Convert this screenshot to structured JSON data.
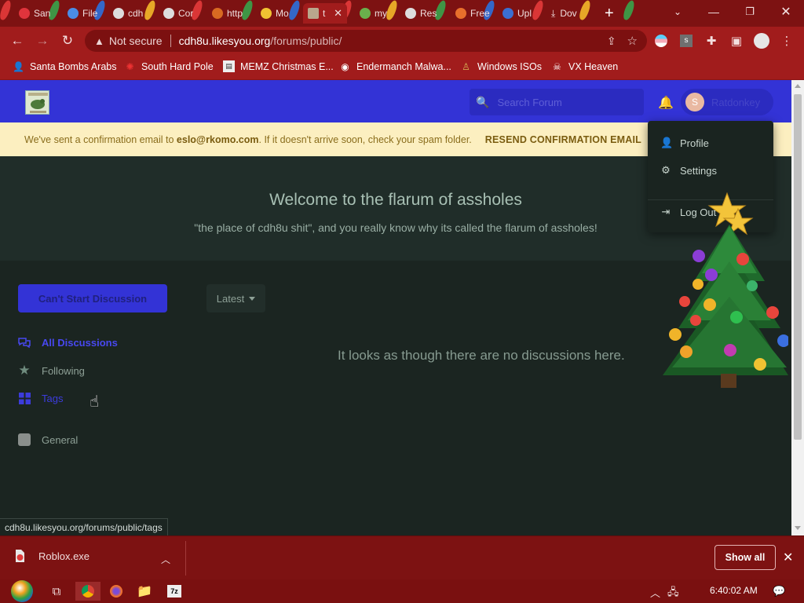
{
  "browser": {
    "tabs": [
      {
        "label": "San",
        "icon": "tab-favicon",
        "color": "#e0343c"
      },
      {
        "label": "File",
        "icon": "tab-favicon",
        "color": "#4b8ce6"
      },
      {
        "label": "cdh",
        "icon": "globe-icon",
        "color": "#dddddd"
      },
      {
        "label": "Cor",
        "icon": "globe-icon",
        "color": "#dddddd"
      },
      {
        "label": "http",
        "icon": "tab-favicon",
        "color": "#d86a22"
      },
      {
        "label": "Mo",
        "icon": "tab-favicon",
        "color": "#f1c232"
      },
      {
        "label": "t",
        "icon": "tab-favicon",
        "color": "#b9a78c",
        "active": true
      },
      {
        "label": "my",
        "icon": "tab-favicon",
        "color": "#6ab04c"
      },
      {
        "label": "Res",
        "icon": "globe-icon",
        "color": "#dddddd"
      },
      {
        "label": "Free",
        "icon": "tab-favicon",
        "color": "#e86f2c"
      },
      {
        "label": "Upl",
        "icon": "tab-favicon",
        "color": "#3b6fd1"
      },
      {
        "label": "Dov",
        "icon": "download-icon",
        "color": "#eeeeee"
      }
    ],
    "new_tab": "+",
    "security_label": "Not secure",
    "url_host": "cdh8u.likesyou.org",
    "url_path": "/forums/public/"
  },
  "bookmarks": [
    {
      "label": "Santa Bombs Arabs",
      "icon": "person-icon"
    },
    {
      "label": "South Hard Pole",
      "icon": "virus-icon"
    },
    {
      "label": "MEMZ Christmas E...",
      "icon": "window-icon"
    },
    {
      "label": "Endermanch Malwa...",
      "icon": "raccoon-icon"
    },
    {
      "label": "Windows ISOs",
      "icon": "figure-icon"
    },
    {
      "label": "VX Heaven",
      "icon": "skull-icon"
    }
  ],
  "forum": {
    "search_placeholder": "Search Forum",
    "username": "Ratdonkey",
    "avatar_letter": "S",
    "alert": {
      "prefix": "We've sent a confirmation email to",
      "email": "eslo@rkomo.com",
      "suffix": ". If it doesn't arrive soon, check your spam folder.",
      "action": "RESEND CONFIRMATION EMAIL"
    },
    "welcome_title": "Welcome to the flarum of assholes",
    "welcome_desc": "\"the place of cdh8u shit\", and you really know why its called the flarum of assholes!",
    "start_button": "Can't Start Discussion",
    "sort_label": "Latest",
    "nav": [
      {
        "label": "All Discussions",
        "icon": "comments-icon"
      },
      {
        "label": "Following",
        "icon": "star-icon"
      },
      {
        "label": "Tags",
        "icon": "tags-grid-icon"
      }
    ],
    "tags": [
      {
        "label": "General",
        "color": "#8a8f8c"
      }
    ],
    "empty_message": "It looks as though there are no discussions here.",
    "user_menu": [
      {
        "label": "Profile",
        "icon": "user-icon"
      },
      {
        "label": "Settings",
        "icon": "gear-icon"
      },
      {
        "label": "Log Out",
        "icon": "sign-out-icon"
      }
    ]
  },
  "status_url": "cdh8u.likesyou.org/forums/public/tags",
  "downloads": {
    "file": "Roblox.exe",
    "show_all": "Show all"
  },
  "taskbar": {
    "time": "6:40:02 AM"
  },
  "colors": {
    "forum_primary": "#3333d6",
    "chrome_theme": "#a11c1c",
    "alert_bg": "#fcefc0"
  }
}
